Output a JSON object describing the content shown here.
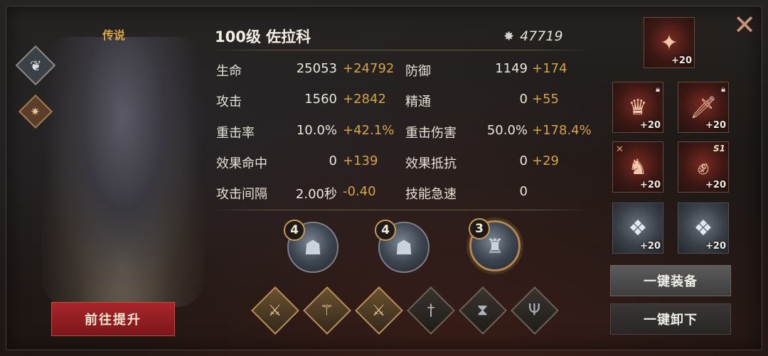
{
  "hero": {
    "rarity": "传说",
    "title": "100级 佐拉科",
    "power": "47719",
    "upgrade_label": "前往提升"
  },
  "stats": [
    {
      "label": "生命",
      "base": "25053",
      "bonus": "+24792"
    },
    {
      "label": "防御",
      "base": "1149",
      "bonus": "+174"
    },
    {
      "label": "攻击",
      "base": "1560",
      "bonus": "+2842"
    },
    {
      "label": "精通",
      "base": "0",
      "bonus": "+55"
    },
    {
      "label": "重击率",
      "base": "10.0%",
      "bonus": "+42.1%"
    },
    {
      "label": "重击伤害",
      "base": "50.0%",
      "bonus": "+178.4%"
    },
    {
      "label": "效果命中",
      "base": "0",
      "bonus": "+139"
    },
    {
      "label": "效果抵抗",
      "base": "0",
      "bonus": "+29"
    },
    {
      "label": "攻击间隔",
      "base": "2.00秒",
      "bonus": "-0.40"
    },
    {
      "label": "技能急速",
      "base": "0",
      "bonus": ""
    }
  ],
  "skills": [
    {
      "count": "4"
    },
    {
      "count": "4"
    },
    {
      "count": "3"
    }
  ],
  "equipment": [
    {
      "level": "+20"
    },
    {
      "level": "+20"
    },
    {
      "level": "+20"
    },
    {
      "level": "+20"
    },
    {
      "level": "+20",
      "tag": "S1"
    },
    {
      "level": "+20"
    },
    {
      "level": "+20"
    }
  ],
  "actions": {
    "equip_all": "一键装备",
    "unequip_all": "一键卸下"
  },
  "icons": {
    "close": "close-icon",
    "power": "power-icon",
    "weapons": [
      "sword-icon",
      "staff-icon",
      "sword-icon",
      "dagger-icon",
      "hourglass-icon",
      "trident-icon"
    ]
  },
  "colors": {
    "bonus": "#d4a44a",
    "rarity": "#d6a84c",
    "upgrade_button": "#9a2226"
  }
}
